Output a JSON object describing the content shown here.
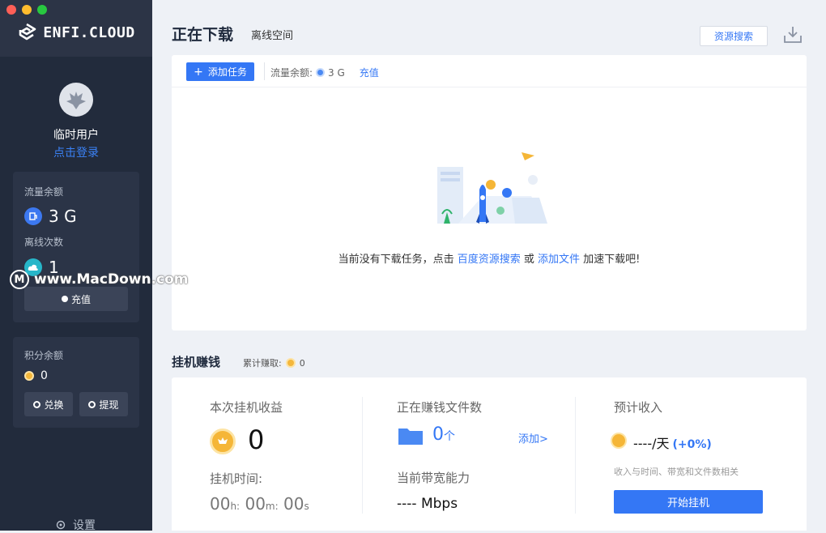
{
  "window": {
    "controls": [
      "close",
      "minimize",
      "zoom"
    ]
  },
  "brand": {
    "name": "ENFI.CLOUD"
  },
  "user": {
    "name": "临时用户",
    "login_link": "点击登录"
  },
  "traffic_card": {
    "traffic_label": "流量余额",
    "traffic_value": "3 G",
    "offline_label": "离线次数",
    "offline_value": "1",
    "recharge_button": "充值"
  },
  "points_card": {
    "label": "积分余额",
    "value": "0",
    "exchange_button": "兑换",
    "withdraw_button": "提现"
  },
  "settings_label": "设置",
  "watermark": {
    "text": "www.MacDown.com",
    "mark": "M"
  },
  "header": {
    "title": "正在下载",
    "subtab": "离线空间",
    "resource_search_button": "资源搜索"
  },
  "toolbar": {
    "add_task_button": "添加任务",
    "quota_label": "流量余额:",
    "quota_value": "3 G",
    "recharge_link": "充值"
  },
  "empty_state": {
    "part1": "当前没有下载任务，点击 ",
    "link1": "百度资源搜索",
    "part2": " 或 ",
    "link2": "添加文件",
    "part3": " 加速下载吧!"
  },
  "earn": {
    "title": "挂机赚钱",
    "total_label": "累计赚取:",
    "total_value": "0",
    "session_label": "本次挂机收益",
    "session_value": "0",
    "time_label": "挂机时间:",
    "time_h": "00",
    "time_h_unit": "h:",
    "time_m": "00",
    "time_m_unit": "m:",
    "time_s": "00",
    "time_s_unit": "s",
    "files_label": "正在赚钱文件数",
    "files_value": "0",
    "files_unit": "个",
    "add_link": "添加>",
    "bandwidth_label": "当前带宽能力",
    "bandwidth_value": "---- Mbps",
    "estimate_label": "预计收入",
    "estimate_value": "----/天",
    "estimate_pct": "(+0%)",
    "estimate_hint": "收入与时间、带宽和文件数相关",
    "start_button": "开始挂机"
  },
  "colors": {
    "accent": "#3477f5",
    "sidebar": "#222b3c",
    "coin": "#f5b637"
  }
}
